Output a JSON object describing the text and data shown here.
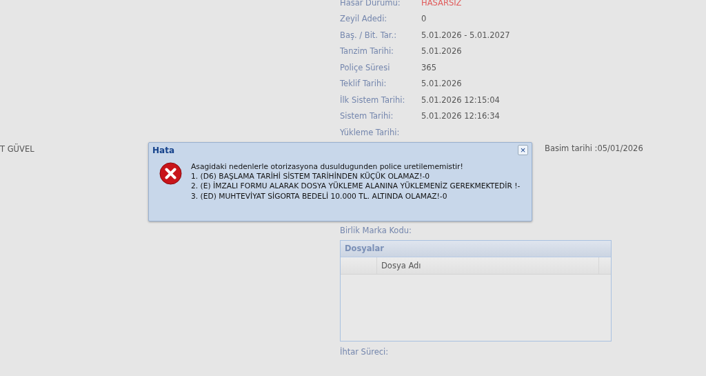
{
  "left_text": "T GÜVEL",
  "fields": [
    {
      "label": "Hasar Durumu:",
      "value": "HASARSIZ",
      "kind": "alert"
    },
    {
      "label": "Zeyil Adedi:",
      "value": "0",
      "kind": "plain"
    },
    {
      "label": "Baş. / Bit. Tar.:",
      "value": "5.01.2026 - 5.01.2027",
      "kind": "plain"
    },
    {
      "label": "Tanzim Tarihi:",
      "value": "5.01.2026",
      "kind": "plain"
    },
    {
      "label": "Poliçe Süresi",
      "value": "365",
      "kind": "plain"
    },
    {
      "label": "Teklif Tarihi:",
      "value": "5.01.2026",
      "kind": "plain"
    },
    {
      "label": "İlk Sistem Tarihi:",
      "value": "5.01.2026 12:15:04",
      "kind": "plain"
    },
    {
      "label": "Sistem Tarihi:",
      "value": "5.01.2026 12:16:34",
      "kind": "plain"
    },
    {
      "label": "Yükleme Tarihi:",
      "kind": "plain"
    }
  ],
  "print_info_tail": "Basim tarihi :05/01/2026",
  "brand_code_label": "Birlik Marka Kodu:",
  "files_grid": {
    "title": "Dosyalar",
    "columns": [
      "Dosya Adı"
    ]
  },
  "warning_period_label": "İhtar Süreci:",
  "dialog": {
    "title": "Hata",
    "close": "×",
    "message": [
      "Asagidaki nedenlerle otorizasyona dusuldugunden police uretilememistir!",
      "1. (D6) BAŞLAMA TARİHİ SİSTEM TARİHİNDEN KÜÇÜK OLAMAZ!-0",
      "2. (E) İMZALI FORMU ALARAK DOSYA YÜKLEME ALANINA YÜKLEMENİZ GEREKMEKTEDİR !-",
      "3. (ED) MUHTEVİYAT SİGORTA BEDELİ 10.000 TL. ALTINDA OLAMAZ!-0"
    ]
  }
}
